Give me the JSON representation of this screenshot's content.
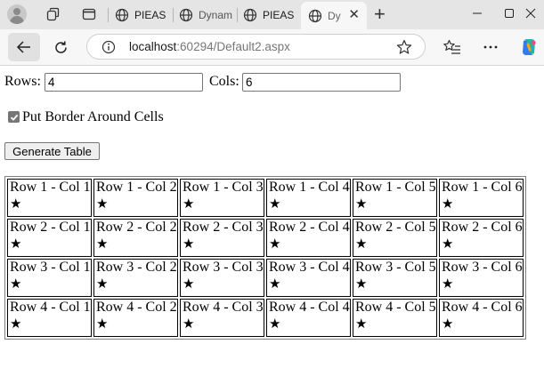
{
  "browser": {
    "tabs": [
      {
        "title": "PIEAS",
        "active": false
      },
      {
        "title": "Dynam",
        "active": false
      },
      {
        "title": "PIEAS",
        "active": false
      },
      {
        "title": "Dy",
        "active": true
      }
    ],
    "new_tab_glyph": "+",
    "close_tab_glyph": "✕",
    "url_host": "localhost",
    "url_rest": ":60294/Default2.aspx"
  },
  "form": {
    "rows_label": "Rows:",
    "rows_value": "4",
    "cols_label": "Cols:",
    "cols_value": "6",
    "border_label": "Put Border Around Cells",
    "border_checked": true,
    "generate_label": "Generate Table"
  },
  "table": {
    "star": "★",
    "rows": [
      [
        "Row 1 - Col 1",
        "Row 1 - Col 2",
        "Row 1 - Col 3",
        "Row 1 - Col 4",
        "Row 1 - Col 5",
        "Row 1 - Col 6"
      ],
      [
        "Row 2 - Col 1",
        "Row 2 - Col 2",
        "Row 2 - Col 3",
        "Row 2 - Col 4",
        "Row 2 - Col 5",
        "Row 2 - Col 6"
      ],
      [
        "Row 3 - Col 1",
        "Row 3 - Col 2",
        "Row 3 - Col 3",
        "Row 3 - Col 4",
        "Row 3 - Col 5",
        "Row 3 - Col 6"
      ],
      [
        "Row 4 - Col 1",
        "Row 4 - Col 2",
        "Row 4 - Col 3",
        "Row 4 - Col 4",
        "Row 4 - Col 5",
        "Row 4 - Col 6"
      ]
    ]
  }
}
